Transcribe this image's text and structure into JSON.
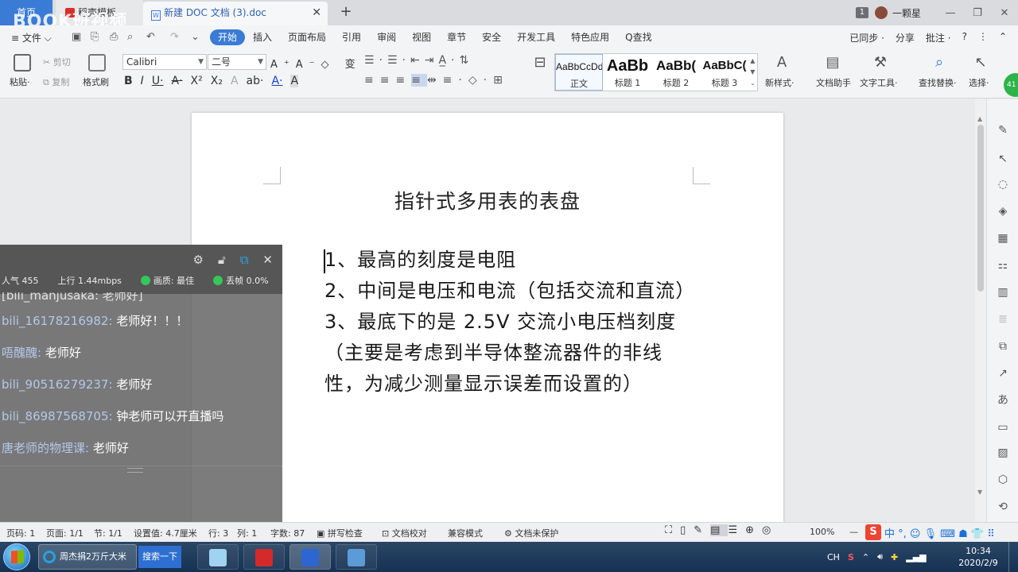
{
  "tabs": {
    "home": "首页",
    "templates": "稻壳模板",
    "document": "新建 DOC 文档 (3).doc",
    "add": "+",
    "close": "✕"
  },
  "watermark": "BOOK班视频",
  "window": {
    "badge": "1",
    "user": "一颗星",
    "minimize": "—",
    "restore": "❐",
    "close": "✕"
  },
  "menu": {
    "file": "≡ 文件 ⌵",
    "items": [
      "开始",
      "插入",
      "页面布局",
      "引用",
      "审阅",
      "视图",
      "章节",
      "安全",
      "开发工具",
      "特色应用",
      "Q查找"
    ],
    "right": [
      "已同步 ·",
      "分享",
      "批注 ·",
      "?",
      "⋮",
      "⌃"
    ]
  },
  "ribbon": {
    "paste": "粘贴·",
    "cut": "剪切",
    "copy": "复制",
    "format_painter": "格式刷",
    "font_name": "Calibri",
    "font_size": "二号",
    "styles": [
      {
        "preview": "AaBbCcDd",
        "name": "正文"
      },
      {
        "preview": "AaBb",
        "name": "标题 1"
      },
      {
        "preview": "AaBb(",
        "name": "标题 2"
      },
      {
        "preview": "AaBbC(",
        "name": "标题 3"
      }
    ],
    "new_style": "新样式·",
    "doc_assistant": "文档助手",
    "text_tools": "文字工具·",
    "find_replace": "查找替换·",
    "select": "选择·"
  },
  "document": {
    "title": "指针式多用表的表盘",
    "paragraphs": [
      "1、最高的刻度是电阻",
      "2、中间是电压和电流（包括交流和直流）",
      "3、最底下的是 2.5V 交流小电压档刻度（主要是考虑到半导体整流器件的非线性，为减少测量显示误差而设置的）"
    ]
  },
  "chat": {
    "popularity_label": "人气",
    "popularity": "455",
    "upload_label": "上行",
    "upload": "1.44mbps",
    "quality_label": "画质: 最佳",
    "drop_label": "丢帧 0.0%",
    "partial_msg": "[bili_manjusaka: 老师好]",
    "messages": [
      {
        "user": "bili_16178216982:",
        "text": " 老师好！！！"
      },
      {
        "user": "唔醜醜:",
        "text": " 老师好"
      },
      {
        "user": "bili_90516279237:",
        "text": " 老师好"
      },
      {
        "user": "bili_86987568705:",
        "text": " 钟老师可以开直播吗"
      },
      {
        "user": "唐老师的物理课:",
        "text": " 老师好"
      }
    ]
  },
  "status": {
    "page_no": "页码: 1",
    "pages": "页面: 1/1",
    "section": "节: 1/1",
    "setting": "设置值: 4.7厘米",
    "row": "行: 3",
    "col": "列: 1",
    "words": "字数: 87",
    "spell": "拼写检查",
    "proof": "文档校对",
    "compat": "兼容模式",
    "protect": "文档未保护",
    "zoom": "100%",
    "zoom_minus": "—"
  },
  "taskbar": {
    "ie_title": "周杰捐2万斤大米",
    "search": "搜索一下",
    "lang": "CH",
    "time": "10:34",
    "date": "2020/2/9"
  },
  "colors": {
    "accent": "#3a7bd5",
    "green": "#2db34a",
    "taskbar": "#1d3a5c"
  }
}
